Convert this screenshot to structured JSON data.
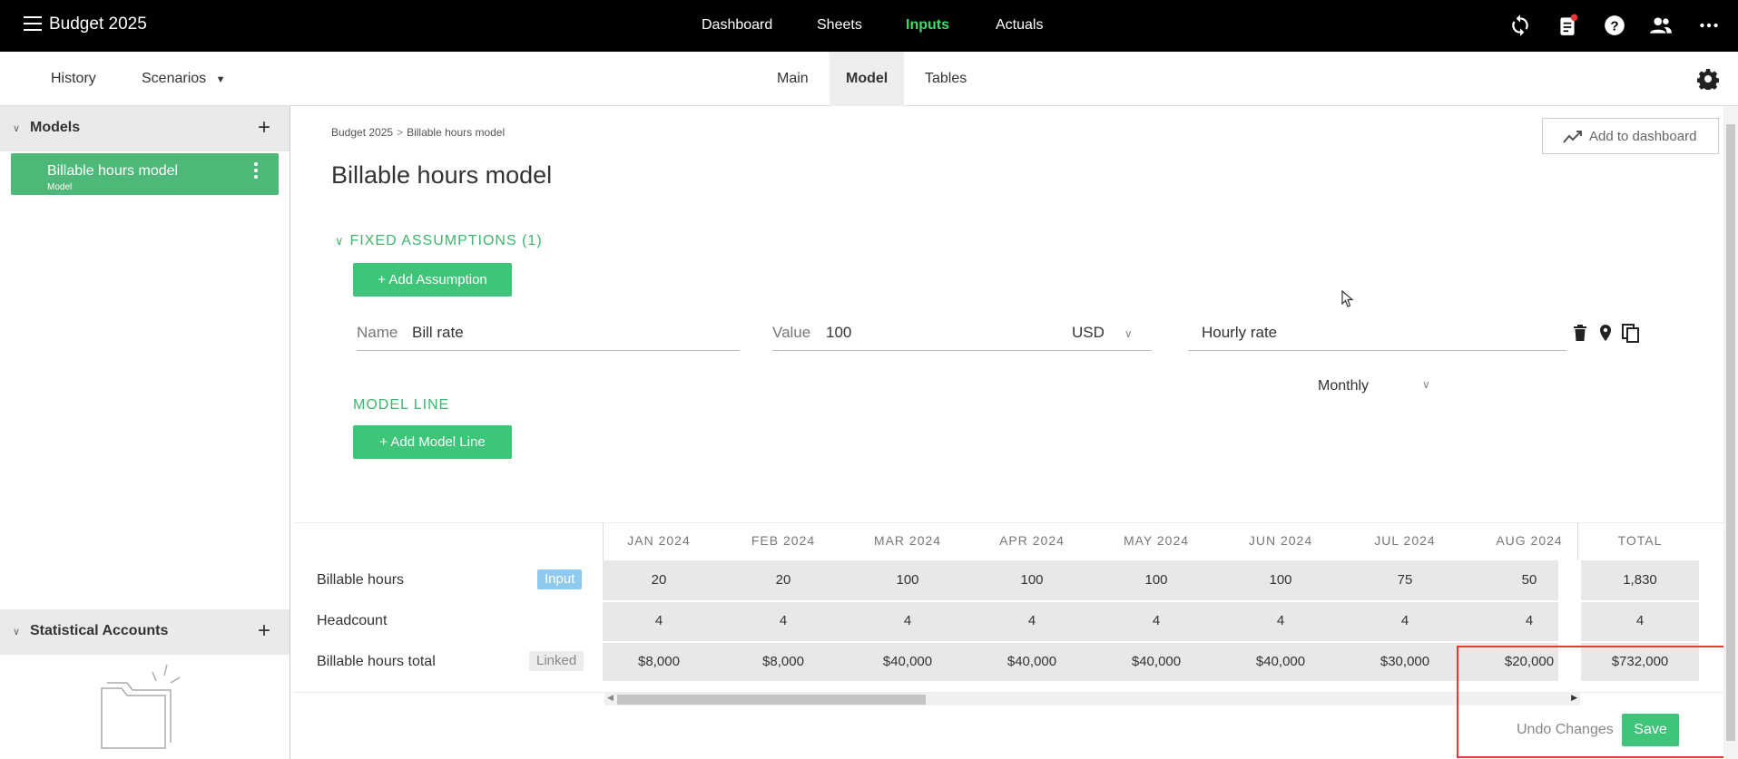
{
  "app": {
    "title": "Budget 2025"
  },
  "topnav": {
    "items": [
      "Dashboard",
      "Sheets",
      "Inputs",
      "Actuals"
    ],
    "active": "Inputs"
  },
  "subnav": {
    "left": {
      "history": "History",
      "scenarios": "Scenarios"
    },
    "tabs": [
      "Main",
      "Model",
      "Tables"
    ],
    "active_tab": "Model"
  },
  "sidebar": {
    "models_header": "Models",
    "model_item": {
      "name": "Billable hours model",
      "sub": "Model"
    },
    "stat_header": "Statistical Accounts"
  },
  "main": {
    "breadcrumb": [
      "Budget 2025",
      "Billable hours model"
    ],
    "breadcrumb_sep": ">",
    "title": "Billable hours model",
    "add_to_dashboard": "Add to dashboard",
    "fixed_assumptions_label": "FIXED ASSUMPTIONS (1)",
    "add_assumption": "+ Add Assumption",
    "assumption": {
      "name_label": "Name",
      "name_value": "Bill rate",
      "value_label": "Value",
      "value": "100",
      "currency": "USD",
      "description": "Hourly rate"
    },
    "model_line_label": "MODEL LINE",
    "add_model_line": "+ Add Model Line",
    "frequency": "Monthly"
  },
  "table": {
    "columns": [
      "JAN 2024",
      "FEB 2024",
      "MAR 2024",
      "APR 2024",
      "MAY 2024",
      "JUN 2024",
      "JUL 2024",
      "AUG 2024"
    ],
    "total_header": "TOTAL",
    "rows": [
      {
        "label": "Billable hours",
        "badge": "Input",
        "values": [
          "20",
          "20",
          "100",
          "100",
          "100",
          "100",
          "75",
          "50"
        ],
        "total": "1,830"
      },
      {
        "label": "Headcount",
        "badge": "",
        "values": [
          "4",
          "4",
          "4",
          "4",
          "4",
          "4",
          "4",
          "4"
        ],
        "total": "4"
      },
      {
        "label": "Billable hours total",
        "badge": "Linked",
        "values": [
          "$8,000",
          "$8,000",
          "$40,000",
          "$40,000",
          "$40,000",
          "$40,000",
          "$30,000",
          "$20,000"
        ],
        "total": "$732,000"
      }
    ]
  },
  "footer": {
    "undo": "Undo Changes",
    "save": "Save"
  },
  "colors": {
    "accent_green": "#3ec57a",
    "topbar_active": "#3ddc6c",
    "highlight": "#e53935",
    "input_badge": "#8fc9ee"
  }
}
